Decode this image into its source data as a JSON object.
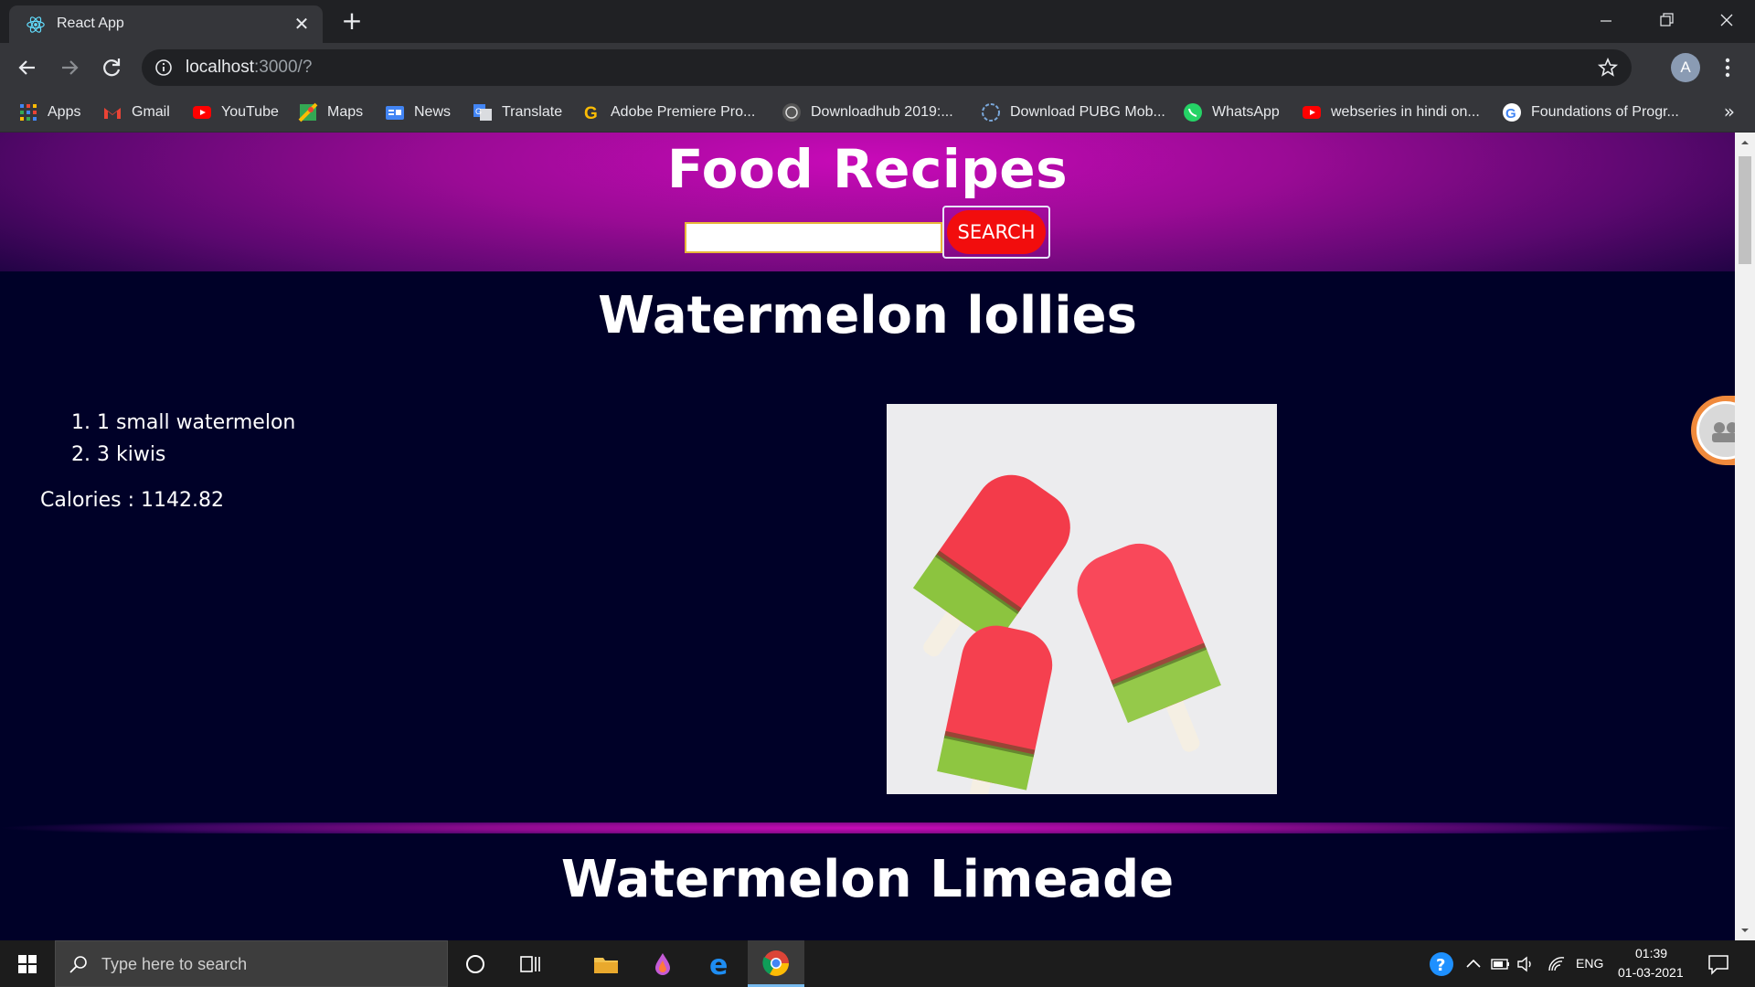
{
  "browser": {
    "tab_title": "React App",
    "new_tab_symbol": "+",
    "close_symbol": "✕",
    "url_host": "localhost",
    "url_path": ":3000/?",
    "profile_initial": "A",
    "more_bookmarks_symbol": "»"
  },
  "bookmarks": [
    {
      "label": "Apps",
      "icon": "apps-grid-icon",
      "color": "#4285f4"
    },
    {
      "label": "Gmail",
      "icon": "gmail-icon",
      "color": "#ea4335"
    },
    {
      "label": "YouTube",
      "icon": "youtube-icon",
      "color": "#ff0000"
    },
    {
      "label": "Maps",
      "icon": "maps-icon",
      "color": "#34a853"
    },
    {
      "label": "News",
      "icon": "news-icon",
      "color": "#4285f4"
    },
    {
      "label": "Translate",
      "icon": "translate-icon",
      "color": "#4285f4"
    },
    {
      "label": "Adobe Premiere Pro...",
      "icon": "google-g-icon",
      "color": "#fbbc05"
    },
    {
      "label": "Downloadhub 2019:...",
      "icon": "downloadhub-icon",
      "color": "#888888"
    },
    {
      "label": "Download PUBG Mob...",
      "icon": "pubg-icon",
      "color": "#7aa7d9"
    },
    {
      "label": "WhatsApp",
      "icon": "whatsapp-icon",
      "color": "#25d366"
    },
    {
      "label": "webseries in hindi on...",
      "icon": "youtube-icon",
      "color": "#ff0000"
    },
    {
      "label": "Foundations of Progr...",
      "icon": "google-icon",
      "color": "#4285f4"
    }
  ],
  "app": {
    "title": "Food Recipes",
    "search_value": "",
    "search_button_label": "SEARCH"
  },
  "recipes": [
    {
      "title": "Watermelon lollies",
      "ingredients": [
        "1. 1 small watermelon",
        "2. 3 kiwis"
      ],
      "calories_label": "Calories : 1142.82"
    },
    {
      "title": "Watermelon Limeade"
    }
  ],
  "taskbar": {
    "search_placeholder": "Type here to search",
    "language": "ENG",
    "time": "01:39",
    "date": "01-03-2021"
  },
  "colors": {
    "page_background": "#000128",
    "header_accent": "#c80ab8",
    "search_button": "#f20d0d"
  }
}
